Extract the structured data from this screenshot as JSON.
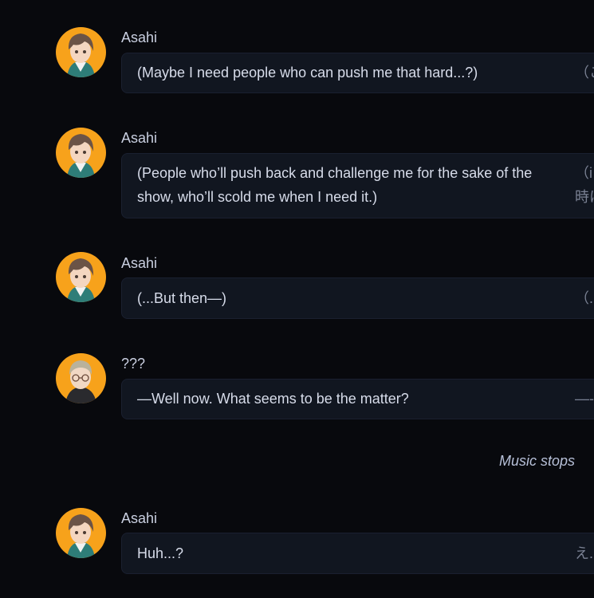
{
  "messages": [
    {
      "speaker": "Asahi",
      "text_en": "(Maybe I need people who can push me that hard...?)",
      "text_jp": "（こ",
      "avatar": "asahi-avatar"
    },
    {
      "speaker": "Asahi",
      "text_en": "(People who’ll push back and challenge me for the sake of the show, who’ll scold me when I need it.)",
      "text_jp": "（i",
      "text_jp_line2": "時に",
      "avatar": "asahi-avatar"
    },
    {
      "speaker": "Asahi",
      "text_en": "(...But then—)",
      "text_jp": "（.",
      "avatar": "asahi-avatar"
    },
    {
      "speaker": "???",
      "text_en": "—Well now. What seems to be the matter?",
      "text_jp": "—-",
      "avatar": "unknown-avatar"
    },
    {
      "speaker": "Asahi",
      "text_en": "Huh...?",
      "text_jp": "え.",
      "avatar": "asahi-avatar"
    }
  ],
  "narration": "Music stops",
  "colors": {
    "background": "#08090d",
    "bubble": "#111620",
    "avatar_bg": "#f7a21b",
    "text": "#d7dcea"
  }
}
